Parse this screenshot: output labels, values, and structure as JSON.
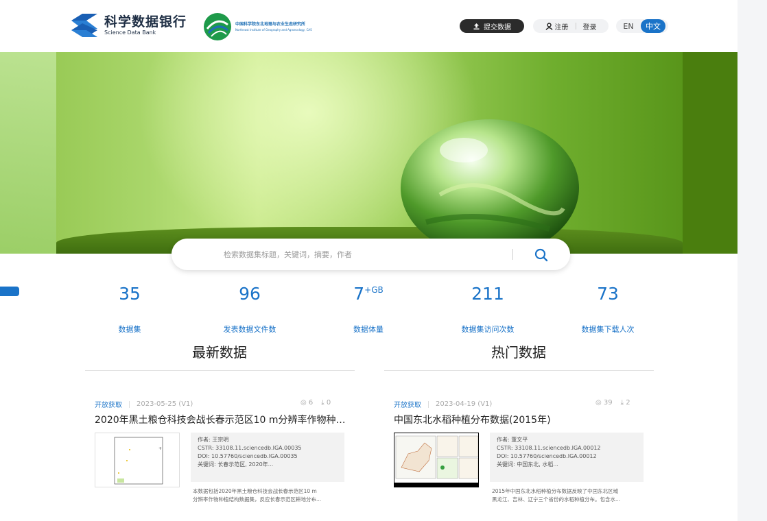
{
  "header": {
    "logo_cn": "科学数据银行",
    "logo_en": "Science Data Bank",
    "partner_cn": "中国科学院东北地理与农业生态研究所",
    "partner_en": "Northeast Institute of Geography and Agroecology, CAS",
    "submit_label": "提交数据",
    "register_label": "注册",
    "login_label": "登录",
    "lang_en": "EN",
    "lang_zh": "中文"
  },
  "search": {
    "placeholder": "检索数据集标题，关键词，摘要，作者"
  },
  "stats": [
    {
      "value": "35",
      "label": "数据集"
    },
    {
      "value": "96",
      "label": "发表数据文件数"
    },
    {
      "value": "7",
      "sup": "+GB",
      "label": "数据体量"
    },
    {
      "value": "211",
      "label": "数据集访问次数"
    },
    {
      "value": "73",
      "label": "数据集下载人次"
    }
  ],
  "sections": {
    "latest": "最新数据",
    "hot": "热门数据"
  },
  "latest_card": {
    "access": "开放获取",
    "date": "2023-05-25 (V1)",
    "views": "6",
    "downloads": "0",
    "title": "2020年黑土粮仓科技会战长春示范区10 m分辨率作物种植结...",
    "author": "作者: 王宗明",
    "cstr": "CSTR: 33108.11.sciencedb.IGA.00035",
    "doi": "DOI: 10.57760/sciencedb.IGA.00035",
    "keywords": "关键词: 长春示范区, 2020年...",
    "desc1": "本数据包括2020年黑土粮仓科技会战长春示范区10 m",
    "desc2": "分辨率作物种植结构数据集，反应长春示范区耕地分布..."
  },
  "hot_card": {
    "access": "开放获取",
    "date": "2023-04-19 (V1)",
    "views": "39",
    "downloads": "2",
    "title": "中国东北水稻种植分布数据(2015年)",
    "author": "作者: 董文平",
    "cstr": "CSTR: 33108.11.sciencedb.IGA.00012",
    "doi": "DOI: 10.57760/sciencedb.IGA.00012",
    "keywords": "关键词: 中国东北, 水稻...",
    "desc1": "2015年中国东北水稻种植分布数据反映了中国东北区域",
    "desc2": "黑龙江、吉林、辽宁三个省份的水稻种植分布。包含水..."
  },
  "colors": {
    "accent": "#1a73c8",
    "dark_button": "#2b2b2b"
  }
}
